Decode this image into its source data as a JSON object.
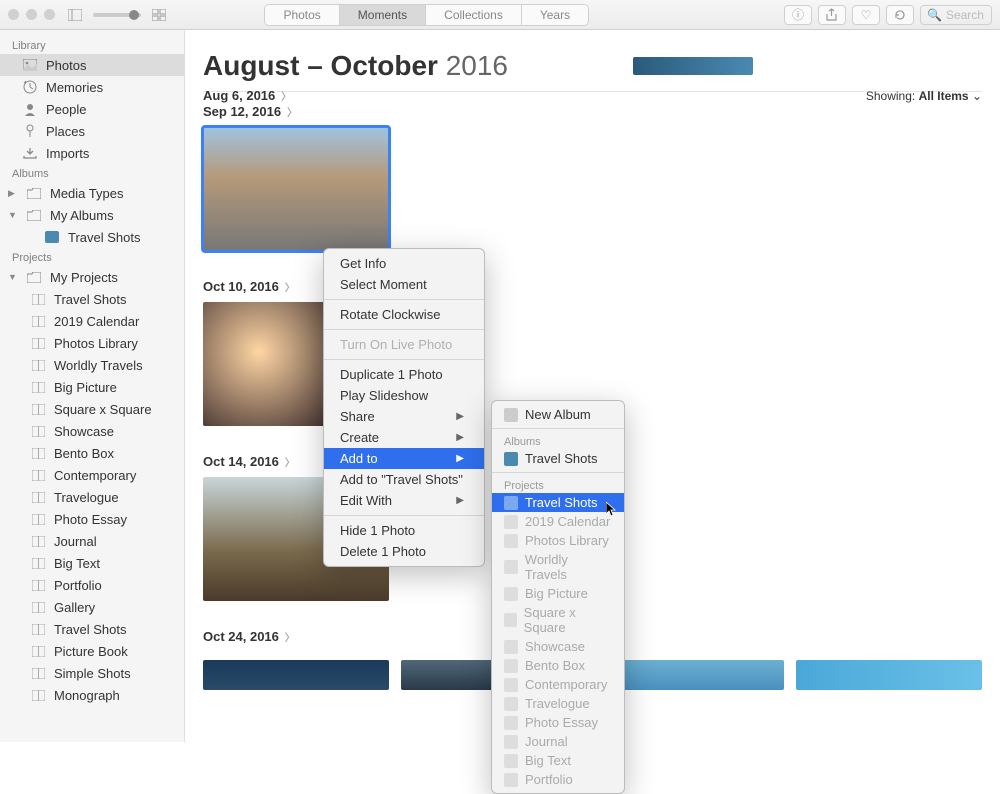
{
  "toolbar": {
    "tabs": [
      "Photos",
      "Moments",
      "Collections",
      "Years"
    ],
    "active_tab": 1,
    "search_placeholder": "Search"
  },
  "sidebar": {
    "library_header": "Library",
    "library": [
      {
        "label": "Photos",
        "icon": "photos"
      },
      {
        "label": "Memories",
        "icon": "clock"
      },
      {
        "label": "People",
        "icon": "person"
      },
      {
        "label": "Places",
        "icon": "pin"
      },
      {
        "label": "Imports",
        "icon": "import"
      }
    ],
    "albums_header": "Albums",
    "albums": [
      {
        "label": "Media Types",
        "icon": "folder",
        "disclosure": "closed"
      },
      {
        "label": "My Albums",
        "icon": "folder",
        "disclosure": "open",
        "children": [
          {
            "label": "Travel Shots",
            "icon": "album-thumb"
          }
        ]
      }
    ],
    "projects_header": "Projects",
    "projects_root": {
      "label": "My Projects",
      "disclosure": "open"
    },
    "projects": [
      {
        "label": "Travel Shots",
        "icon": "book",
        "hl": true
      },
      {
        "label": "2019 Calendar",
        "icon": "book"
      },
      {
        "label": "Photos Library",
        "icon": "book"
      },
      {
        "label": "Worldly Travels",
        "icon": "book"
      },
      {
        "label": "Big Picture",
        "icon": "book"
      },
      {
        "label": "Square x Square",
        "icon": "book"
      },
      {
        "label": "Showcase",
        "icon": "book"
      },
      {
        "label": "Bento Box",
        "icon": "book"
      },
      {
        "label": "Contemporary",
        "icon": "book"
      },
      {
        "label": "Travelogue",
        "icon": "book"
      },
      {
        "label": "Photo Essay",
        "icon": "book"
      },
      {
        "label": "Journal",
        "icon": "book"
      },
      {
        "label": "Big Text",
        "icon": "book"
      },
      {
        "label": "Portfolio",
        "icon": "book"
      },
      {
        "label": "Gallery",
        "icon": "book"
      },
      {
        "label": "Travel Shots",
        "icon": "book"
      },
      {
        "label": "Picture Book",
        "icon": "book"
      },
      {
        "label": "Simple Shots",
        "icon": "book"
      },
      {
        "label": "Monograph",
        "icon": "book"
      }
    ]
  },
  "content": {
    "title_main": "August – October",
    "title_year": "2016",
    "showing_label": "Showing:",
    "showing_value": "All Items",
    "moments": [
      {
        "date": "Aug 6, 2016"
      },
      {
        "date": "Sep 12, 2016",
        "selected": true
      },
      {
        "date": "Oct 10, 2016"
      },
      {
        "date": "Oct 14, 2016"
      },
      {
        "date": "Oct 24, 2016"
      }
    ]
  },
  "context_menu": {
    "items": [
      {
        "label": "Get Info"
      },
      {
        "label": "Select Moment"
      },
      {
        "sep": true
      },
      {
        "label": "Rotate Clockwise"
      },
      {
        "sep": true
      },
      {
        "label": "Turn On Live Photo",
        "disabled": true
      },
      {
        "sep": true
      },
      {
        "label": "Duplicate 1 Photo"
      },
      {
        "label": "Play Slideshow"
      },
      {
        "label": "Share",
        "submenu": true
      },
      {
        "label": "Create",
        "submenu": true
      },
      {
        "label": "Add to",
        "submenu": true,
        "highlight": true
      },
      {
        "label": "Add to \"Travel Shots\""
      },
      {
        "label": "Edit With",
        "submenu": true
      },
      {
        "sep": true
      },
      {
        "label": "Hide 1 Photo"
      },
      {
        "label": "Delete 1 Photo"
      }
    ]
  },
  "submenu": {
    "new_album": "New Album",
    "albums_header": "Albums",
    "albums": [
      {
        "label": "Travel Shots",
        "enabled": true
      }
    ],
    "projects_header": "Projects",
    "projects": [
      {
        "label": "Travel Shots",
        "highlight": true
      },
      {
        "label": "2019 Calendar"
      },
      {
        "label": "Photos Library"
      },
      {
        "label": "Worldly Travels"
      },
      {
        "label": "Big Picture"
      },
      {
        "label": "Square x Square"
      },
      {
        "label": "Showcase"
      },
      {
        "label": "Bento Box"
      },
      {
        "label": "Contemporary"
      },
      {
        "label": "Travelogue"
      },
      {
        "label": "Photo Essay"
      },
      {
        "label": "Journal"
      },
      {
        "label": "Big Text"
      },
      {
        "label": "Portfolio"
      }
    ]
  }
}
